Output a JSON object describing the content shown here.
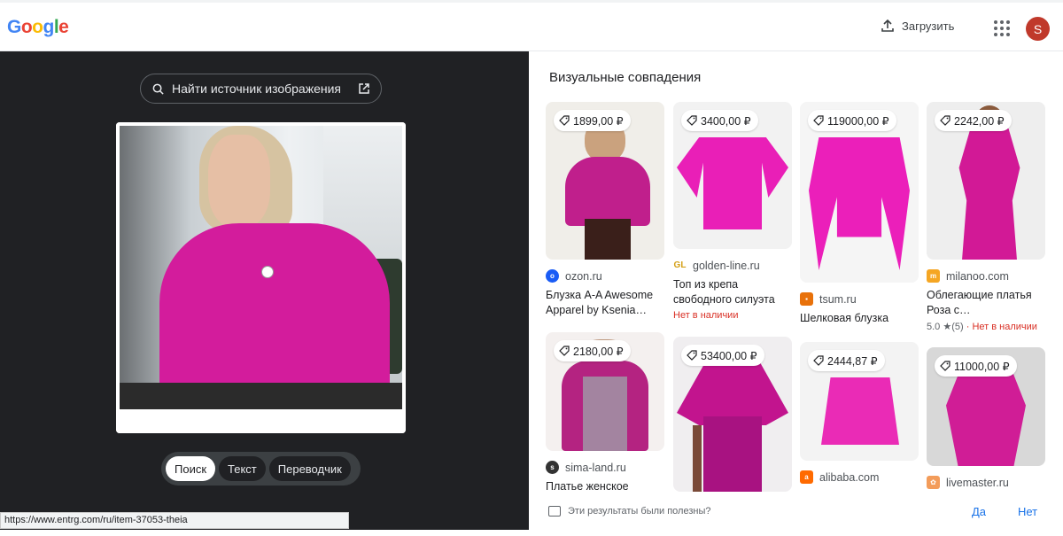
{
  "header": {
    "logo": "Google",
    "upload_label": "Загрузить",
    "avatar_letter": "S"
  },
  "left": {
    "find_source_label": "Найти источник изображения",
    "tabs": [
      {
        "label": "Поиск",
        "active": true
      },
      {
        "label": "Текст",
        "active": false
      },
      {
        "label": "Переводчик",
        "active": false
      }
    ],
    "status_url": "https://www.entrg.com/ru/item-37053-theia"
  },
  "results": {
    "title": "Визуальные совпадения",
    "items": [
      {
        "price": "1899,00 ₽",
        "site": "ozon.ru",
        "title": "Блузка A-A Awesome Apparel by Ksenia…",
        "meta": ""
      },
      {
        "price": "3400,00 ₽",
        "site": "golden-line.ru",
        "title": "Топ из крепа свободного силуэта",
        "meta": "Нет в наличии"
      },
      {
        "price": "119000,00 ₽",
        "site": "tsum.ru",
        "title": "Шелковая блузка",
        "meta": ""
      },
      {
        "price": "2242,00 ₽",
        "site": "milanoo.com",
        "title": "Облегающие платья Роза с…",
        "rating": "5.0 ★(5)",
        "meta": "Нет в наличии"
      },
      {
        "price": "2180,00 ₽",
        "site": "sima-land.ru",
        "title": "Платье женское",
        "meta": ""
      },
      {
        "price": "53400,00 ₽",
        "site": "",
        "title": "",
        "meta": ""
      },
      {
        "price": "2444,87 ₽",
        "site": "alibaba.com",
        "title": "",
        "meta": ""
      },
      {
        "price": "11000,00 ₽",
        "site": "livemaster.ru",
        "title": "",
        "meta": ""
      }
    ],
    "favicon_letters": {
      "golden": "GL"
    }
  },
  "feedback": {
    "question": "Эти результаты были полезны?",
    "yes": "Да",
    "no": "Нет"
  },
  "colors": {
    "magenta": "#d31c9c",
    "dark_bg": "#202124",
    "link_blue": "#1a73e8",
    "out_of_stock_red": "#d93025"
  }
}
